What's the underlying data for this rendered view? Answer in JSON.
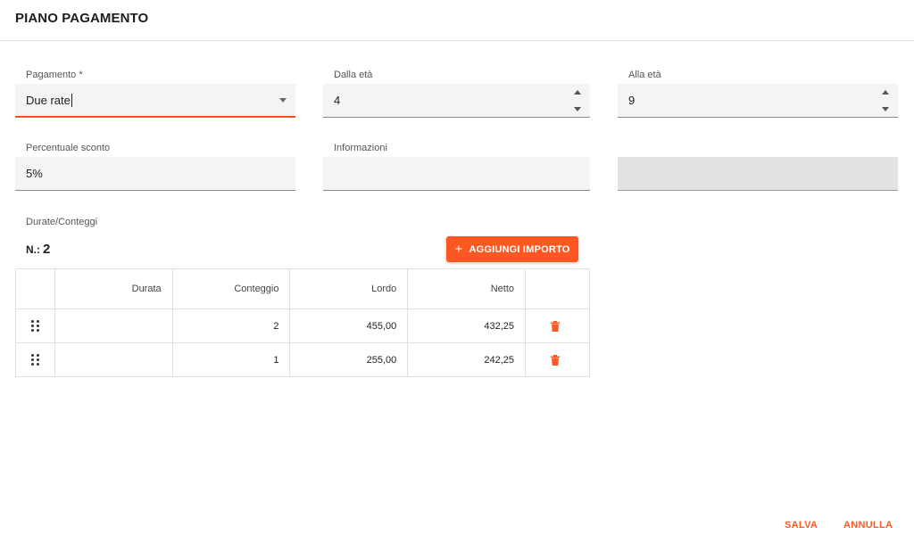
{
  "header": {
    "title": "PIANO PAGAMENTO"
  },
  "fields": {
    "pagamento": {
      "label": "Pagamento *",
      "value": "Due rate"
    },
    "dalla_eta": {
      "label": "Dalla età",
      "value": "4"
    },
    "alla_eta": {
      "label": "Alla età",
      "value": "9"
    },
    "percentuale_sconto": {
      "label": "Percentuale sconto",
      "value": "5%"
    },
    "informazioni": {
      "label": "Informazioni",
      "value": ""
    },
    "extra": {
      "value": ""
    }
  },
  "durate": {
    "section_label": "Durate/Conteggi",
    "count_label": "N.:",
    "count_value": "2",
    "add_button": "AGGIUNGI IMPORTO",
    "columns": [
      "",
      "Durata",
      "Conteggio",
      "Lordo",
      "Netto",
      ""
    ],
    "rows": [
      {
        "durata": "",
        "conteggio": "2",
        "lordo": "455,00",
        "netto": "432,25"
      },
      {
        "durata": "",
        "conteggio": "1",
        "lordo": "255,00",
        "netto": "242,25"
      }
    ]
  },
  "footer": {
    "save": "SALVA",
    "cancel": "ANNULLA"
  },
  "colors": {
    "accent": "#ff5722",
    "input_bg": "#f4f4f4",
    "disabled_bg": "#e2e2e2"
  }
}
